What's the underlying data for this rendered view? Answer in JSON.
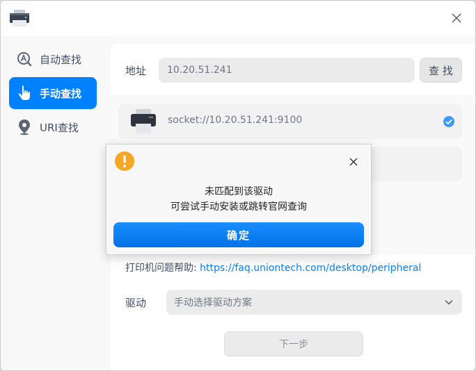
{
  "titlebar": {
    "app_icon": "printer-app-icon",
    "close_icon": "close-icon"
  },
  "sidebar": {
    "items": [
      {
        "label": "自动查找",
        "icon": "auto-search-icon",
        "active": false
      },
      {
        "label": "手动查找",
        "icon": "hand-pointer-icon",
        "active": true
      },
      {
        "label": "URI查找",
        "icon": "location-pin-icon",
        "active": false
      }
    ]
  },
  "main": {
    "address_label": "地址",
    "address_value": "10.20.51.241",
    "find_button": "查 找",
    "devices": [
      {
        "uri": "socket://10.20.51.241:9100",
        "selected": true
      }
    ],
    "help_label": "打印机问题帮助:",
    "help_link": "https://faq.uniontech.com/desktop/peripheral",
    "driver_label": "驱动",
    "driver_value": "手动选择驱动方案",
    "next_button": "下一步"
  },
  "dialog": {
    "title": "未匹配到该驱动",
    "message": "可尝试手动安装或跳转官网查询",
    "ok_button": "确定"
  },
  "colors": {
    "accent": "#0081ff",
    "warning": "#f5a623"
  }
}
